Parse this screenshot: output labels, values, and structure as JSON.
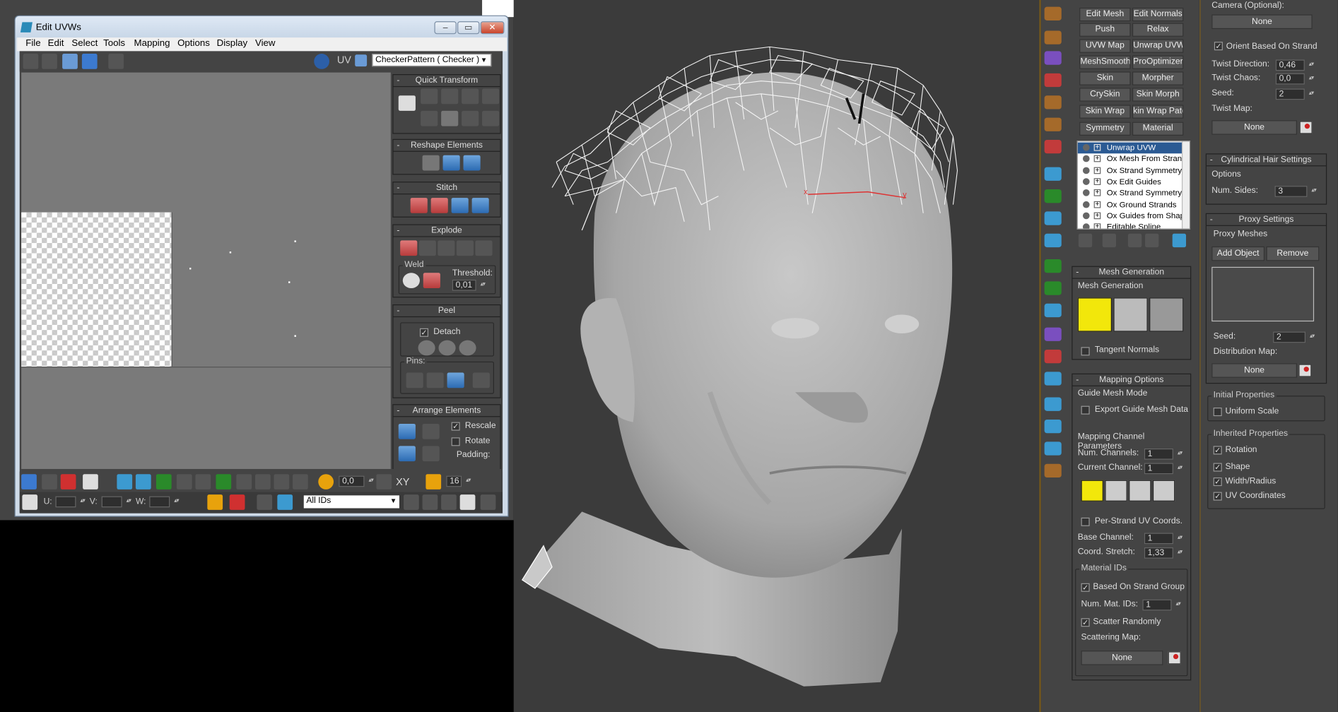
{
  "uvw_window": {
    "title": "Edit UVWs",
    "controls": {
      "minimize": "–",
      "maximize": "▭",
      "close": "✕"
    },
    "menu": [
      "File",
      "Edit",
      "Select",
      "Tools",
      "Mapping",
      "Options",
      "Display",
      "View"
    ],
    "uv_label": "UV",
    "texture_dropdown": "CheckerPattern  ( Checker )",
    "rollouts": {
      "quick_transform": "Quick Transform",
      "reshape_elements": "Reshape Elements",
      "stitch": "Stitch",
      "explode": "Explode",
      "weld_label": "Weld",
      "threshold_label": "Threshold:",
      "threshold_value": "0,01",
      "peel": "Peel",
      "detach_label": "Detach",
      "pins_label": "Pins:",
      "arrange_elements": "Arrange Elements",
      "rescale_label": "Rescale",
      "rotate_label": "Rotate",
      "padding_label": "Padding:"
    },
    "bottom": {
      "soft_value": "0,0",
      "xy_label": "XY",
      "grid_value": "16",
      "u_label": "U:",
      "v_label": "V:",
      "w_label": "W:",
      "ids_dropdown": "All IDs"
    }
  },
  "modifier_buttons": [
    [
      "Edit Mesh",
      "Edit Normals"
    ],
    [
      "Push",
      "Relax"
    ],
    [
      "UVW Map",
      "Unwrap UVW"
    ],
    [
      "MeshSmooth",
      "ProOptimizer"
    ],
    [
      "Skin",
      "Morpher"
    ],
    [
      "CrySkin",
      "Skin Morph"
    ],
    [
      "Skin Wrap",
      "kin Wrap Patch"
    ],
    [
      "Symmetry",
      "Material"
    ]
  ],
  "modifier_stack": [
    {
      "name": "Unwrap UVW",
      "selected": true
    },
    {
      "name": "Ox Mesh From Strands",
      "selected": false
    },
    {
      "name": "Ox Strand Symmetry",
      "selected": false
    },
    {
      "name": "Ox Edit Guides",
      "selected": false
    },
    {
      "name": "Ox Strand Symmetry",
      "selected": false
    },
    {
      "name": "Ox Ground Strands",
      "selected": false
    },
    {
      "name": "Ox Guides from Shape",
      "selected": false
    },
    {
      "name": "Editable Spline",
      "selected": false
    }
  ],
  "mesh_generation": {
    "title": "Mesh Generation",
    "group": "Mesh Generation",
    "tangent_normals": "Tangent Normals"
  },
  "mapping_options": {
    "title": "Mapping Options",
    "guide_mesh_mode": "Guide Mesh Mode",
    "export_guide": "Export Guide Mesh Data",
    "mcp_group": "Mapping Channel Parameters",
    "num_channels_label": "Num. Channels:",
    "num_channels_value": "1",
    "current_channel_label": "Current Channel:",
    "current_channel_value": "1",
    "per_strand": "Per-Strand UV Coords.",
    "base_channel_label": "Base Channel:",
    "base_channel_value": "1",
    "coord_stretch_label": "Coord. Stretch:",
    "coord_stretch_value": "1,33",
    "material_ids": "Material IDs",
    "based_on_group": "Based On Strand Group",
    "num_mat_ids_label": "Num. Mat. IDs:",
    "num_mat_ids_value": "1",
    "scatter_randomly": "Scatter Randomly",
    "scattering_map": "Scattering Map:",
    "none": "None"
  },
  "props": {
    "camera_label": "Camera (Optional):",
    "camera_none": "None",
    "orient": "Orient Based On Strand",
    "twist_direction_label": "Twist Direction:",
    "twist_direction_value": "0,46",
    "twist_chaos_label": "Twist Chaos:",
    "twist_chaos_value": "0,0",
    "seed_label": "Seed:",
    "seed_value": "2",
    "twist_map_label": "Twist Map:",
    "twist_map_none": "None",
    "cyl_title": "Cylindrical Hair Settings",
    "options_group": "Options",
    "num_sides_label": "Num. Sides:",
    "num_sides_value": "3",
    "proxy_title": "Proxy Settings",
    "proxy_meshes": "Proxy Meshes",
    "add_object": "Add Object",
    "remove": "Remove",
    "proxy_seed_label": "Seed:",
    "proxy_seed_value": "2",
    "distribution_map_label": "Distribution Map:",
    "distribution_none": "None",
    "initial_props": "Initial Properties",
    "uniform_scale": "Uniform Scale",
    "inherited_props": "Inherited Properties",
    "rotation": "Rotation",
    "shape": "Shape",
    "width_radius": "Width/Radius",
    "uv_coords": "UV Coordinates"
  },
  "viewport": {
    "axis_x": "x",
    "axis_y": "y"
  },
  "colors": {
    "selection_blue": "#2b5a93",
    "viewport_bg": "#3b3b3b",
    "panel_bg": "#444444",
    "highlight_yellow": "#f2e70b"
  }
}
